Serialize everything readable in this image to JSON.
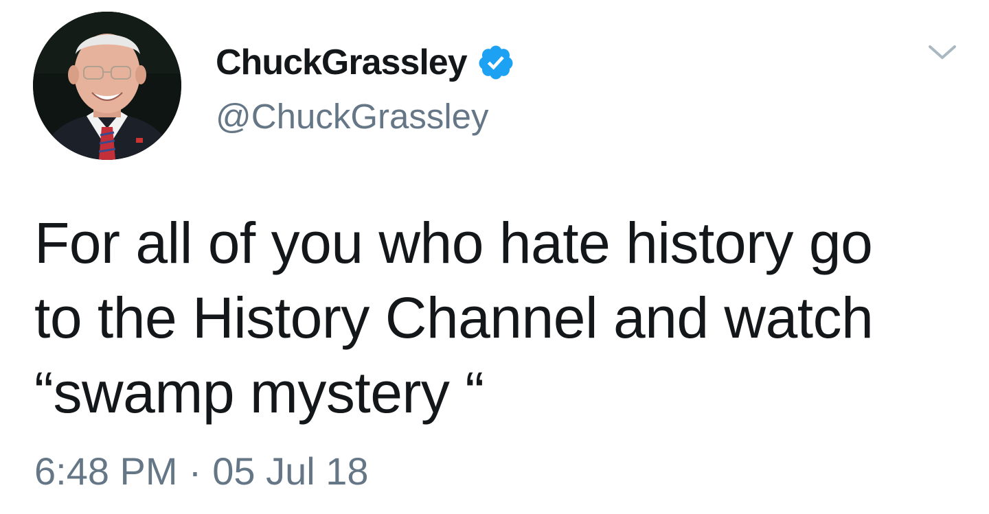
{
  "user": {
    "display_name": "ChuckGrassley",
    "handle": "@ChuckGrassley",
    "verified": true,
    "verified_badge_color": "#1da1f2",
    "avatar_icon": "profile-photo"
  },
  "tweet": {
    "text_lines": [
      "For all of you who hate history go",
      "to the History Channel and watch",
      "“swamp mystery “"
    ],
    "time": "6:48 PM",
    "separator": "·",
    "date": "05 Jul 18"
  },
  "menu": {
    "icon": "chevron-down-icon"
  },
  "colors": {
    "text_primary": "#14171a",
    "text_secondary": "#657786",
    "background": "#ffffff"
  }
}
